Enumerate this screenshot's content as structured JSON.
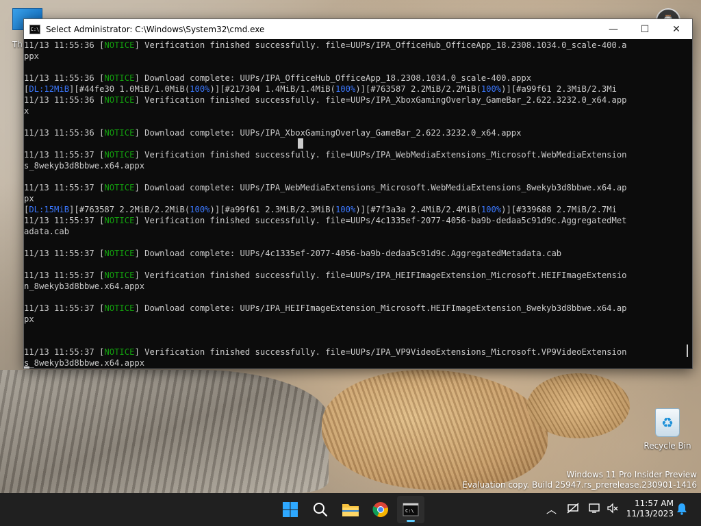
{
  "desktop": {
    "top_left_text": "Th",
    "recycle_bin_label": "Recycle Bin",
    "watermark_line1": "Windows 11 Pro Insider Preview",
    "watermark_line2": "Evaluation copy. Build 25947.rs_prerelease.230901-1416"
  },
  "window": {
    "title": "Select Administrator: C:\\Windows\\System32\\cmd.exe",
    "minimize_symbol": "—",
    "maximize_symbol": "☐",
    "close_symbol": "✕"
  },
  "console": {
    "lines": [
      {
        "pre": "11/13 11:55:36 [",
        "tag": "NOTICE",
        "post": "] Verification finished successfully. file=UUPs/IPA_OfficeHub_OfficeApp_18.2308.1034.0_scale-400.a"
      },
      {
        "text": "ppx"
      },
      {
        "text": ""
      },
      {
        "pre": "11/13 11:55:36 [",
        "tag": "NOTICE",
        "post": "] Download complete: UUPs/IPA_OfficeHub_OfficeApp_18.2308.1034.0_scale-400.appx"
      },
      {
        "dl": "12MiB",
        "rest": [
          [
            "#44fe30 1.0MiB/1.0MiB",
            "100%"
          ],
          [
            "#217304 1.4MiB/1.4MiB",
            "100%"
          ],
          [
            "#763587 2.2MiB/2.2MiB",
            "100%"
          ]
        ],
        "tail": "#a99f61 2.3MiB/2.3Mi"
      },
      {
        "pre": "11/13 11:55:36 [",
        "tag": "NOTICE",
        "post": "] Verification finished successfully. file=UUPs/IPA_XboxGamingOverlay_GameBar_2.622.3232.0_x64.app"
      },
      {
        "text": "x"
      },
      {
        "text": ""
      },
      {
        "pre": "11/13 11:55:36 [",
        "tag": "NOTICE",
        "post": "] Download complete: UUPs/IPA_XboxGamingOverlay_GameBar_2.622.3232.0_x64.appx"
      },
      {
        "text": ""
      },
      {
        "pre": "11/13 11:55:37 [",
        "tag": "NOTICE",
        "post": "] Verification finished successfully. file=UUPs/IPA_WebMediaExtensions_Microsoft.WebMediaExtension"
      },
      {
        "text": "s_8wekyb3d8bbwe.x64.appx"
      },
      {
        "text": ""
      },
      {
        "pre": "11/13 11:55:37 [",
        "tag": "NOTICE",
        "post": "] Download complete: UUPs/IPA_WebMediaExtensions_Microsoft.WebMediaExtensions_8wekyb3d8bbwe.x64.ap"
      },
      {
        "text": "px"
      },
      {
        "dl": "15MiB",
        "rest": [
          [
            "#763587 2.2MiB/2.2MiB",
            "100%"
          ],
          [
            "#a99f61 2.3MiB/2.3MiB",
            "100%"
          ],
          [
            "#7f3a3a 2.4MiB/2.4MiB",
            "100%"
          ]
        ],
        "tail": "#339688 2.7MiB/2.7Mi"
      },
      {
        "pre": "11/13 11:55:37 [",
        "tag": "NOTICE",
        "post": "] Verification finished successfully. file=UUPs/4c1335ef-2077-4056-ba9b-dedaa5c91d9c.AggregatedMet"
      },
      {
        "text": "adata.cab"
      },
      {
        "text": ""
      },
      {
        "pre": "11/13 11:55:37 [",
        "tag": "NOTICE",
        "post": "] Download complete: UUPs/4c1335ef-2077-4056-ba9b-dedaa5c91d9c.AggregatedMetadata.cab"
      },
      {
        "text": ""
      },
      {
        "pre": "11/13 11:55:37 [",
        "tag": "NOTICE",
        "post": "] Verification finished successfully. file=UUPs/IPA_HEIFImageExtension_Microsoft.HEIFImageExtensio"
      },
      {
        "text": "n_8wekyb3d8bbwe.x64.appx"
      },
      {
        "text": ""
      },
      {
        "pre": "11/13 11:55:37 [",
        "tag": "NOTICE",
        "post": "] Download complete: UUPs/IPA_HEIFImageExtension_Microsoft.HEIFImageExtension_8wekyb3d8bbwe.x64.ap"
      },
      {
        "text": "px"
      },
      {
        "text": ""
      },
      {
        "text": ""
      },
      {
        "pre": "11/13 11:55:37 [",
        "tag": "NOTICE",
        "post": "] Verification finished successfully. file=UUPs/IPA_VP9VideoExtensions_Microsoft.VP9VideoExtension"
      },
      {
        "text": "s_8wekyb3d8bbwe.x64.appx"
      }
    ]
  },
  "taskbar": {
    "apps": [
      {
        "name": "start-icon",
        "glyph": "⊞"
      },
      {
        "name": "search-icon",
        "glyph": "⌕"
      },
      {
        "name": "file-explorer-icon",
        "glyph": "▬"
      },
      {
        "name": "chrome-icon",
        "glyph": "◉"
      },
      {
        "name": "terminal-icon",
        "glyph": "C:\\"
      }
    ],
    "tray": {
      "chevron": "︿",
      "network": "⛔",
      "display": "▭",
      "volume": "🔇",
      "notification": "🔔"
    },
    "time": "11:57 AM",
    "date": "11/13/2023"
  },
  "colors": {
    "console_bg": "#0c0c0c",
    "console_text": "#cccccc",
    "notice_green": "#13a10e",
    "progress_blue": "#3b78ff",
    "taskbar_bg": "#202020",
    "accent": "#60cdff"
  }
}
